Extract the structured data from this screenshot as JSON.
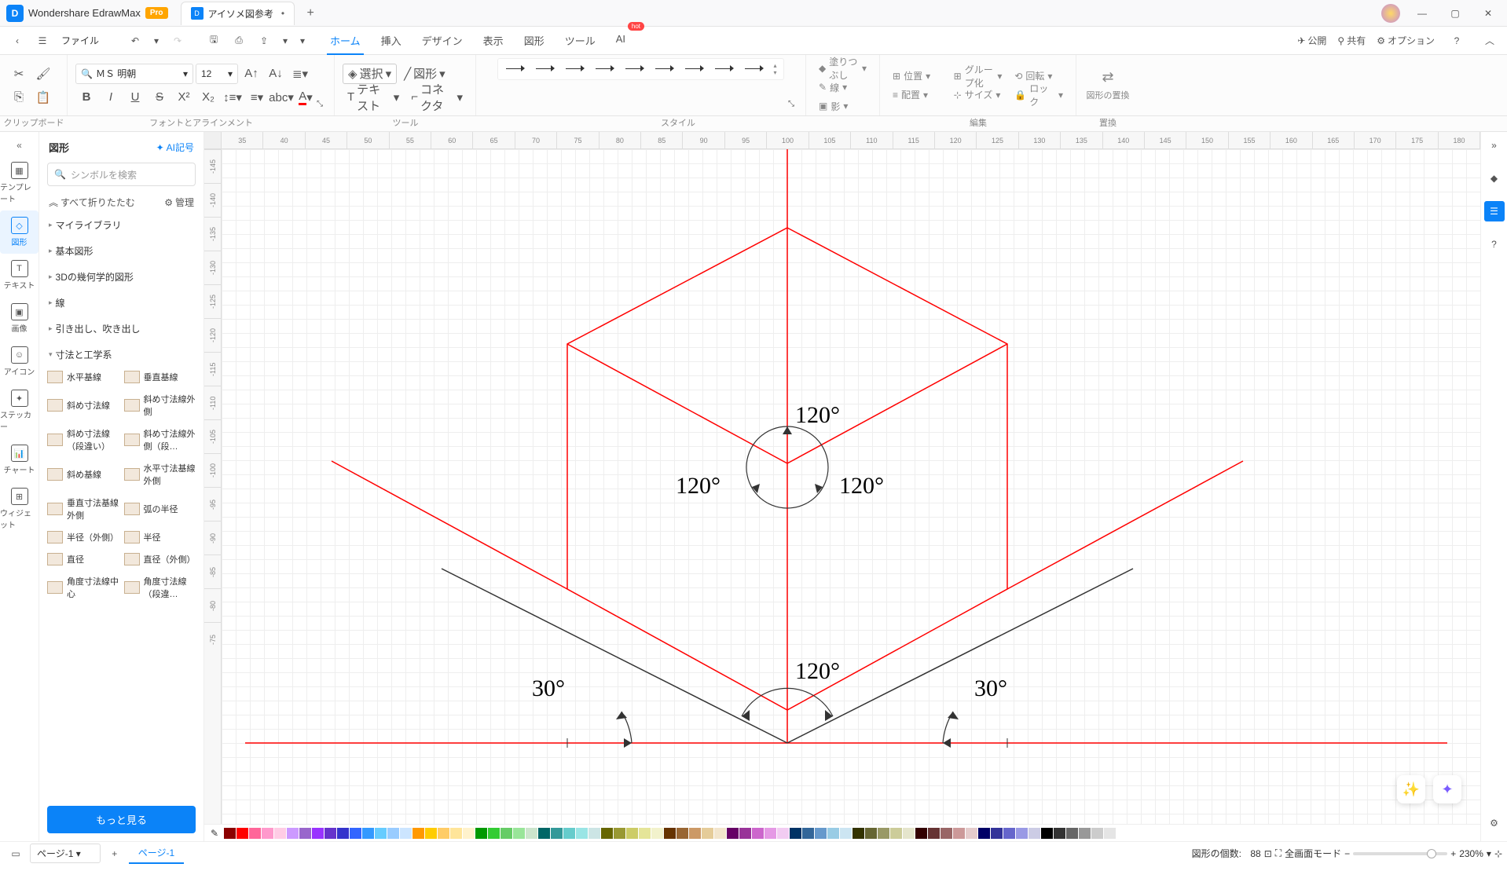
{
  "app": {
    "name": "Wondershare EdrawMax",
    "badge": "Pro"
  },
  "doc": {
    "title": "アイソメ図参考",
    "dirty": "•"
  },
  "file_menu": "ファイル",
  "menu_tabs": [
    "ホーム",
    "挿入",
    "デザイン",
    "表示",
    "図形",
    "ツール",
    "AI"
  ],
  "menubar_right": {
    "publish": "公開",
    "share": "共有",
    "options": "オプション"
  },
  "ribbon": {
    "font": "ＭＳ 明朝",
    "size": "12",
    "select": "選択",
    "shape": "図形",
    "text": "テキスト",
    "connector": "コネクタ",
    "fill": "塗りつぶし",
    "line": "線",
    "shadow": "影",
    "position": "位置",
    "align": "配置",
    "group": "グループ化",
    "sizem": "サイズ",
    "rotate": "回転",
    "lock": "ロック",
    "replace": "図形の置換",
    "groups": {
      "clipboard": "クリップボード",
      "font": "フォントとアラインメント",
      "tool": "ツール",
      "style": "スタイル",
      "edit": "編集",
      "replace": "置換"
    }
  },
  "shapes_panel": {
    "title": "図形",
    "ai": "AI記号",
    "search_placeholder": "シンボルを検索",
    "collapse": "すべて折りたたむ",
    "manage": "管理",
    "cats": [
      "マイライブラリ",
      "基本図形",
      "3Dの幾何学的図形",
      "線",
      "引き出し、吹き出し",
      "寸法と工学系"
    ],
    "items": [
      "水平基線",
      "垂直基線",
      "斜め寸法線",
      "斜め寸法線外側",
      "斜め寸法線（段違い）",
      "斜め寸法線外側（段…",
      "斜め基線",
      "水平寸法基線外側",
      "垂直寸法基線外側",
      "弧の半径",
      "半径（外側）",
      "半径",
      "直径",
      "直径（外側）",
      "角度寸法線中心",
      "角度寸法線（段違…"
    ],
    "more": "もっと見る"
  },
  "left_rail": [
    "テンプレート",
    "図形",
    "テキスト",
    "画像",
    "アイコン",
    "ステッカー",
    "チャート",
    "ウィジェット"
  ],
  "ruler_h": [
    "35",
    "40",
    "45",
    "50",
    "55",
    "60",
    "65",
    "70",
    "75",
    "80",
    "85",
    "90",
    "95",
    "100",
    "105",
    "110",
    "115",
    "120",
    "125",
    "130",
    "135",
    "140",
    "145",
    "150",
    "155",
    "160",
    "165",
    "170",
    "175",
    "180"
  ],
  "ruler_v": [
    "-145",
    "-140",
    "-135",
    "-130",
    "-125",
    "-120",
    "-115",
    "-110",
    "-105",
    "-100",
    "-95",
    "-90",
    "-85",
    "-80",
    "-75"
  ],
  "canvas_labels": {
    "a120_top": "120°",
    "a120_left": "120°",
    "a120_right": "120°",
    "a120_bottom": "120°",
    "a30_left": "30°",
    "a30_right": "30°"
  },
  "status": {
    "shape_count_label": "図形の個数:",
    "shape_count": "88",
    "mode": "全画面モード",
    "zoom": "230%"
  },
  "pages": {
    "dropdown": "ページ-1",
    "tab": "ページ-1"
  },
  "colors": [
    "#8B0000",
    "#FF0000",
    "#FF6699",
    "#FF99CC",
    "#FFCCE5",
    "#CC99FF",
    "#9966CC",
    "#9933FF",
    "#6633CC",
    "#3333CC",
    "#3366FF",
    "#3399FF",
    "#66CCFF",
    "#99CCFF",
    "#CCE5FF",
    "#FF9900",
    "#FFCC00",
    "#FFCC66",
    "#FFE599",
    "#FFF2CC",
    "#009900",
    "#33CC33",
    "#66CC66",
    "#99E599",
    "#CCE5CC",
    "#006666",
    "#339999",
    "#66CCCC",
    "#99E5E5",
    "#CCE5E5",
    "#666600",
    "#999933",
    "#CCCC66",
    "#E5E599",
    "#F2F2CC",
    "#663300",
    "#996633",
    "#CC9966",
    "#E5CC99",
    "#F2E5CC",
    "#660066",
    "#993399",
    "#CC66CC",
    "#E599E5",
    "#F2CCF2",
    "#003366",
    "#336699",
    "#6699CC",
    "#99CCE5",
    "#CCE5F2",
    "#333300",
    "#666633",
    "#999966",
    "#CCCC99",
    "#E5E5CC",
    "#330000",
    "#663333",
    "#996666",
    "#CC9999",
    "#E5CCCC",
    "#000066",
    "#333399",
    "#6666CC",
    "#9999E5",
    "#CCCCE5",
    "#000000",
    "#333333",
    "#666666",
    "#999999",
    "#CCCCCC",
    "#E5E5E5",
    "#FFFFFF"
  ]
}
